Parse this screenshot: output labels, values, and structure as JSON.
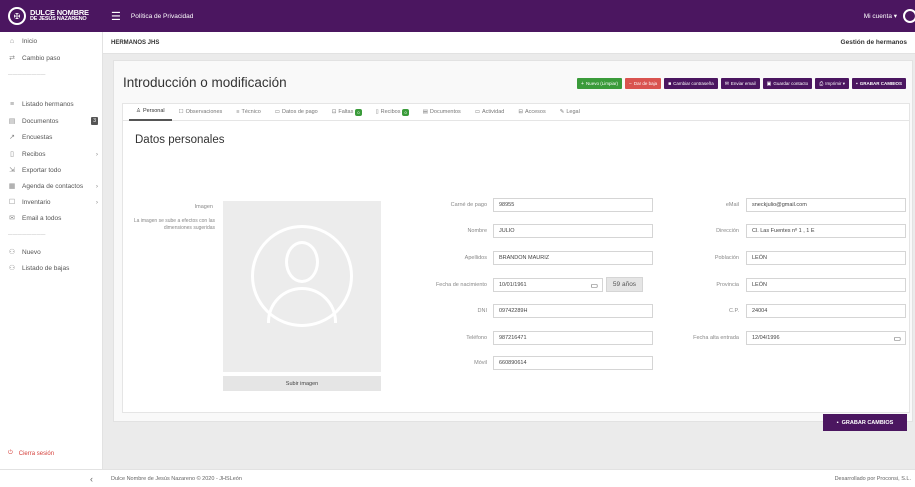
{
  "topbar": {
    "logo_line1": "DULCE NOMBRE",
    "logo_line2": "DE JESÚS NAZARENO",
    "menu_icon": "hamburger-icon",
    "title": "Política de Privacidad",
    "account": "Mi cuenta ▾"
  },
  "sidebar": {
    "items": [
      {
        "label": "Inicio",
        "icon": "home-icon"
      },
      {
        "label": "Cambio paso",
        "icon": "swap-icon"
      },
      {
        "label": "Listado hermanos",
        "icon": "list-icon"
      },
      {
        "label": "Documentos",
        "icon": "document-icon",
        "badge": "3"
      },
      {
        "label": "Encuestas",
        "icon": "survey-icon"
      },
      {
        "label": "Recibos",
        "icon": "receipt-icon"
      },
      {
        "label": "Exportar todo",
        "icon": "export-icon"
      },
      {
        "label": "Agenda de contactos",
        "icon": "agenda-icon"
      },
      {
        "label": "Inventario",
        "icon": "inventory-icon"
      },
      {
        "label": "Email a todos",
        "icon": "email-icon"
      },
      {
        "label": "Nuevo",
        "icon": "add-user-icon"
      },
      {
        "label": "Listado de bajas",
        "icon": "user-minus-icon"
      }
    ],
    "logout": "Cierra sesión"
  },
  "header": {
    "left": "HERMANOS JHS",
    "right": "Gestión de hermanos"
  },
  "main": {
    "title": "Introducción o modificación",
    "toolbar": [
      {
        "label": "Nuevo (Limpiar)",
        "color": "#3a9b3a",
        "icon": "plus-icon"
      },
      {
        "label": "Dar de baja",
        "color": "#d9534f",
        "icon": "minus-icon"
      },
      {
        "label": "Cambiar contraseña",
        "color": "#4b1660",
        "icon": "lock-icon"
      },
      {
        "label": "Enviar email",
        "color": "#4b1660",
        "icon": "envelope-icon"
      },
      {
        "label": "Guardar contacto",
        "color": "#4b1660",
        "icon": "save-contact-icon"
      },
      {
        "label": "Imprimir ▾",
        "color": "#4b1660",
        "icon": "print-icon"
      },
      {
        "label": "GRABAR CAMBIOS",
        "color": "#4b1660",
        "icon": "save-icon"
      }
    ],
    "tabs": [
      {
        "label": "Personal",
        "icon": "person-icon"
      },
      {
        "label": "Observaciones",
        "icon": "note-icon"
      },
      {
        "label": "Técnico",
        "icon": "tech-icon"
      },
      {
        "label": "Datos de pago",
        "icon": "card-icon"
      },
      {
        "label": "Faltas",
        "icon": "absence-icon",
        "badge": "0"
      },
      {
        "label": "Recibos",
        "icon": "receipt-icon",
        "badge": "0"
      },
      {
        "label": "Documentos",
        "icon": "folder-icon"
      },
      {
        "label": "Actividad",
        "icon": "activity-icon"
      },
      {
        "label": "Accesos",
        "icon": "access-icon"
      },
      {
        "label": "Legal",
        "icon": "legal-icon"
      }
    ],
    "section_title": "Datos personales",
    "image_label": "Imagen",
    "image_note": "La imagen se sube a efectos con las dimensiones sugeridas",
    "upload_label": "Subir imagen",
    "fields_left": [
      {
        "label": "Carné de pago",
        "value": "98955"
      },
      {
        "label": "Nombre",
        "value": "JULIO"
      },
      {
        "label": "Apellidos",
        "value": "BRANDON MAURIZ"
      },
      {
        "label": "Fecha de nacimiento",
        "value": "10/01/1961"
      },
      {
        "label": "DNI",
        "value": "09742289H"
      },
      {
        "label": "Teléfono",
        "value": "987216471"
      },
      {
        "label": "Móvil",
        "value": "660890614"
      }
    ],
    "age": "59 años",
    "fields_right": [
      {
        "label": "eMail",
        "value": "sneckjulio@gmail.com"
      },
      {
        "label": "Dirección",
        "value": "Cl. Las Fuentes nº 1 , 1 E"
      },
      {
        "label": "Población",
        "value": "LEÓN"
      },
      {
        "label": "Provincia",
        "value": "LEÓN"
      },
      {
        "label": "C.P.",
        "value": "24004"
      },
      {
        "label": "Fecha alta entrada",
        "value": "12/04/1996"
      }
    ],
    "save_label": "GRABAR CAMBIOS"
  },
  "footer": {
    "left": "Dulce Nombre de Jesús Nazareno © 2020 - JHSLeón",
    "right": "Desarrollado por Proconsi, S.L."
  }
}
